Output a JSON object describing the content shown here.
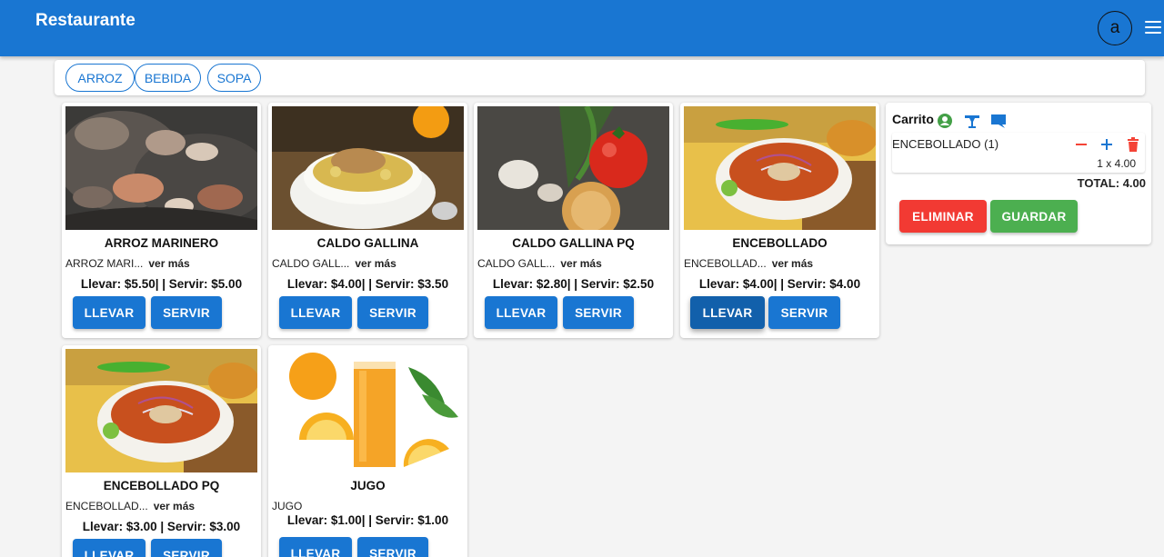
{
  "app": {
    "title": "Restaurante",
    "user_initial": "a"
  },
  "categories": [
    {
      "label": "ARROZ"
    },
    {
      "label": "BEBIDA"
    },
    {
      "label": "SOPA"
    }
  ],
  "products": [
    {
      "name": "ARROZ MARINERO",
      "desc": "ARROZ MARI...",
      "more": "ver más",
      "price": "Llevar: $5.50| | Servir: $5.00",
      "take_label": "LLEVAR",
      "serve_label": "SERVIR",
      "image": "seafood-rice-photo"
    },
    {
      "name": "CALDO GALLINA",
      "desc": "CALDO GALL...",
      "more": "ver más",
      "price": "Llevar: $4.00| | Servir: $3.50",
      "take_label": "LLEVAR",
      "serve_label": "SERVIR",
      "image": "chicken-soup-photo"
    },
    {
      "name": "CALDO GALLINA PQ",
      "desc": "CALDO GALL...",
      "more": "ver más",
      "price": "Llevar: $2.80| | Servir: $2.50",
      "take_label": "LLEVAR",
      "serve_label": "SERVIR",
      "image": "vegetables-photo"
    },
    {
      "name": "ENCEBOLLADO",
      "desc": "ENCEBOLLAD...",
      "more": "ver más",
      "price": "Llevar: $4.00| | Servir: $4.00",
      "take_label": "LLEVAR",
      "serve_label": "SERVIR",
      "image": "encebollado-photo"
    },
    {
      "name": "ENCEBOLLADO PQ",
      "desc": "ENCEBOLLAD...",
      "more": "ver más",
      "price": "Llevar: $3.00 | Servir: $3.00",
      "take_label": "LLEVAR",
      "serve_label": "SERVIR",
      "image": "encebollado-photo"
    },
    {
      "name": "JUGO",
      "desc": "JUGO",
      "more": "",
      "price": "Llevar: $1.00| | Servir: $1.00",
      "take_label": "LLEVAR",
      "serve_label": "SERVIR",
      "image": "orange-juice-photo"
    }
  ],
  "cart": {
    "title": "Carrito",
    "icons": [
      "account-circle-icon",
      "table-icon",
      "comment-icon"
    ],
    "items": [
      {
        "name": "ENCEBOLLADO (1)",
        "qty_line": "1 x 4.00"
      }
    ],
    "total": "TOTAL: 4.00",
    "delete_label": "ELIMINAR",
    "save_label": "GUARDAR"
  },
  "colors": {
    "primary": "#1976d2",
    "danger": "#f23a33",
    "success": "#4caf50"
  }
}
